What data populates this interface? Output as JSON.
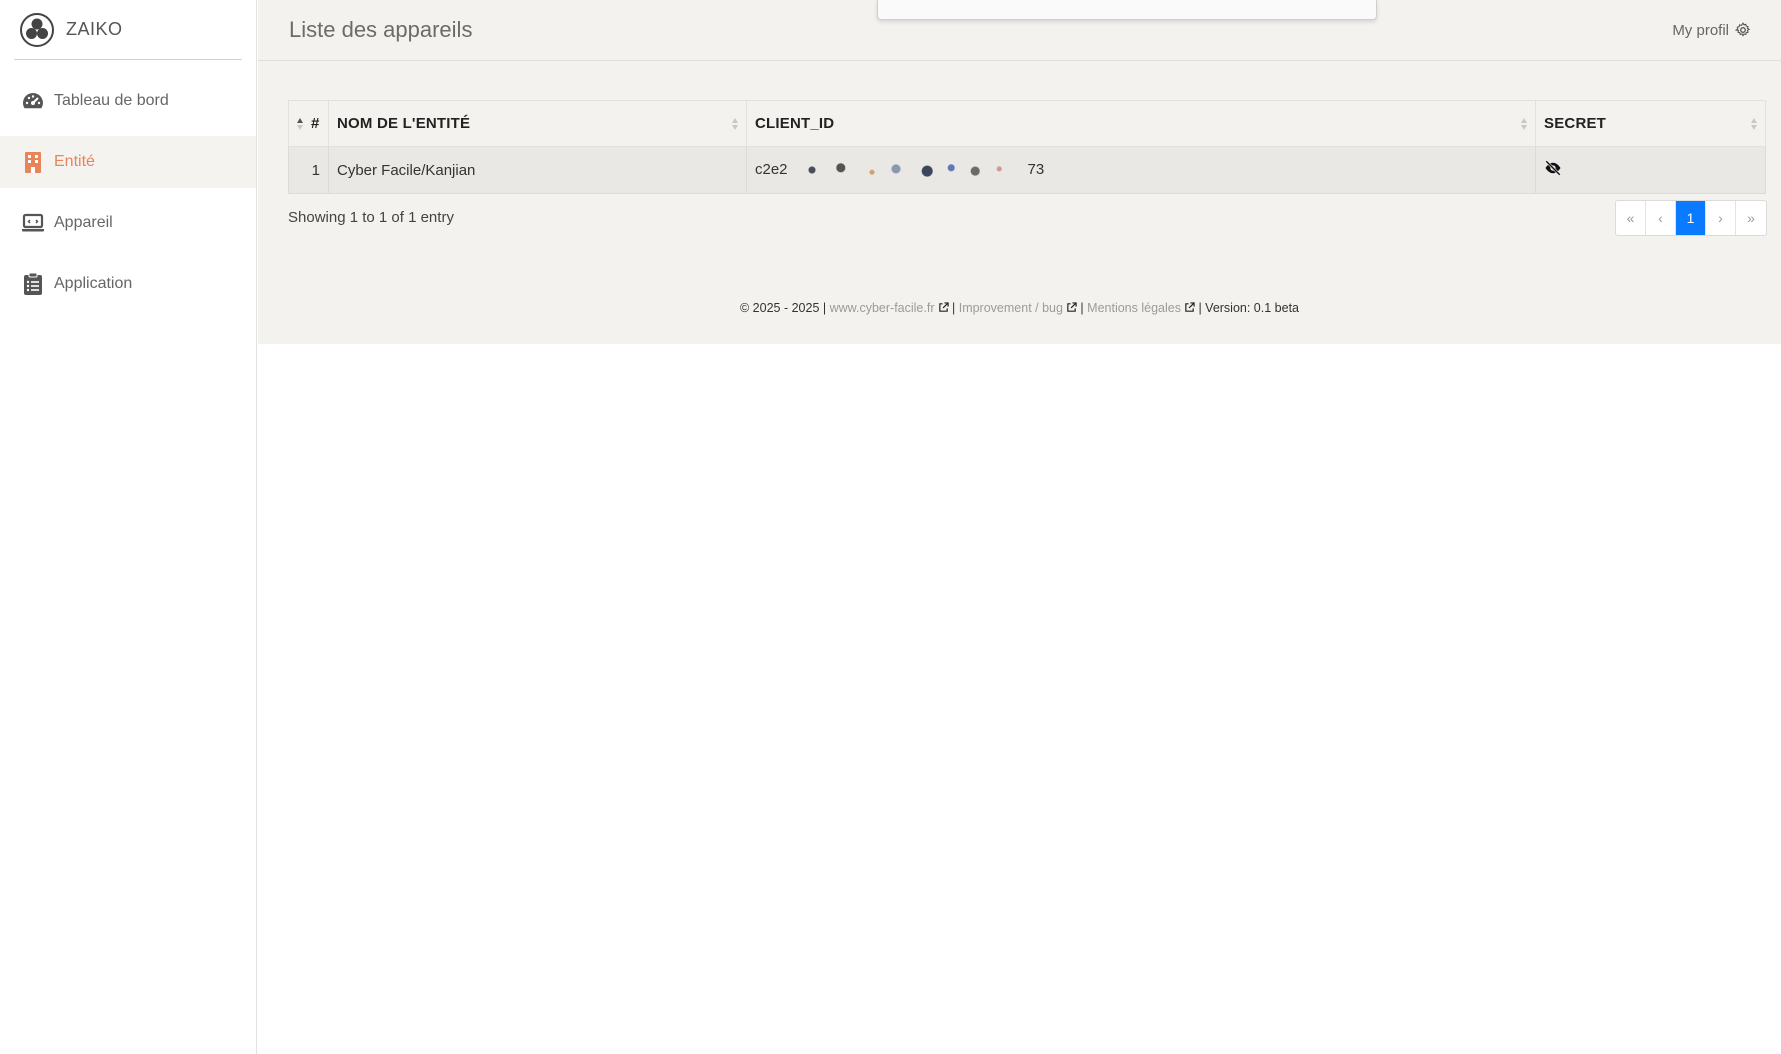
{
  "brand": {
    "name": "ZAIKO"
  },
  "sidebar": {
    "items": [
      {
        "label": "Tableau de bord",
        "icon": "dashboard-gauge-icon",
        "active": false
      },
      {
        "label": "Entité",
        "icon": "building-icon",
        "active": true
      },
      {
        "label": "Appareil",
        "icon": "laptop-icon",
        "active": false
      },
      {
        "label": "Application",
        "icon": "clipboard-list-icon",
        "active": false
      }
    ]
  },
  "header": {
    "title": "Liste des appareils",
    "profile_label": "My profil"
  },
  "table": {
    "columns": [
      "#",
      "NOM DE L'ENTITÉ",
      "CLIENT_ID",
      "SECRET"
    ],
    "rows": [
      {
        "index": "1",
        "name": "Cyber Facile/Kanjian",
        "client_id_prefix": "c2e2",
        "client_id_suffix": "73",
        "secret": "eye-slash-icon"
      }
    ]
  },
  "showing": "Showing 1 to 1 of 1 entry",
  "pagination": {
    "first": "«",
    "prev": "‹",
    "current": "1",
    "next": "›",
    "last": "»"
  },
  "footer": {
    "copyright": "© 2025 - 2025 |",
    "site_link": "www.cyber-facile.fr",
    "sep1": "|",
    "improvement_link": "Improvement / bug",
    "sep2": "|",
    "legal_link": "Mentions légales",
    "version": "| Version: 0.1 beta"
  },
  "colors": {
    "accent": "#e8845a",
    "primary": "#0a7bff",
    "background": "#f3f2ef"
  }
}
